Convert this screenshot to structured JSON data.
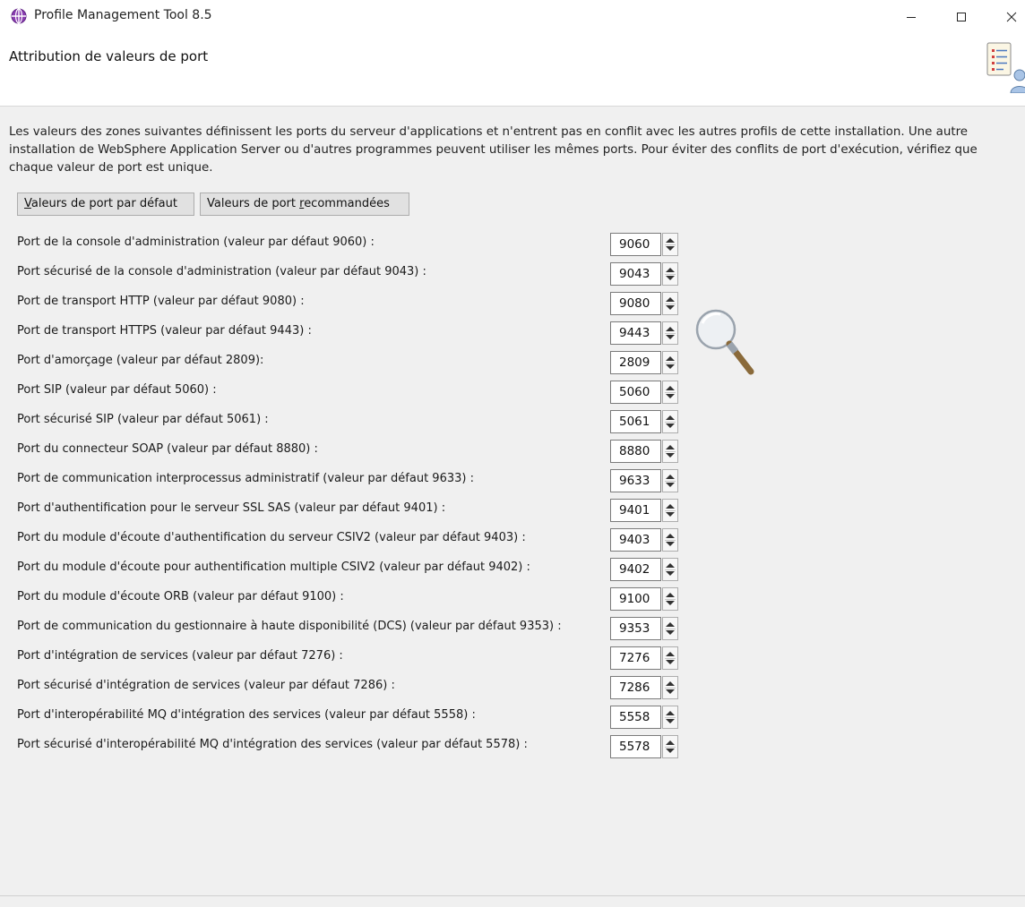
{
  "window": {
    "title": "Profile Management Tool 8.5",
    "controls": [
      "minimize-icon",
      "maximize-icon",
      "close-icon"
    ]
  },
  "header": {
    "title": "Attribution de valeurs de port",
    "image_icon": "checklist-user-icon"
  },
  "description": {
    "line1": "Les valeurs des zones suivantes définissent les ports du serveur d'applications et n'entrent pas en conflit avec les autres profils de cette installation. Une autre",
    "line2": "installation de WebSphere Application Server ou d'autres programmes peuvent utiliser les mêmes ports. Pour éviter des conflits de port d'exécution, vérifiez que",
    "line3": "chaque valeur de port est unique."
  },
  "buttons": {
    "default_ports": {
      "mnemonic": "V",
      "rest": "aleurs de port par défaut"
    },
    "recommended_ports": {
      "before": "Valeurs de port ",
      "mnemonic": "r",
      "after": "ecommandées"
    }
  },
  "ports": [
    {
      "label": "Port de la console d'administration (valeur par défaut 9060) :",
      "value": "9060"
    },
    {
      "label": "Port sécurisé de la console d'administration (valeur par défaut 9043) :",
      "value": "9043"
    },
    {
      "label": "Port de transport HTTP (valeur par défaut 9080) :",
      "value": "9080"
    },
    {
      "label": "Port de transport HTTPS (valeur par défaut 9443) :",
      "value": "9443"
    },
    {
      "label": "Port d'amorçage (valeur par défaut 2809):",
      "value": "2809"
    },
    {
      "label": "Port SIP (valeur par défaut 5060) :",
      "value": "5060"
    },
    {
      "label": "Port sécurisé SIP (valeur par défaut 5061) :",
      "value": "5061"
    },
    {
      "label": "Port du connecteur SOAP (valeur par défaut 8880) :",
      "value": "8880"
    },
    {
      "label": "Port de communication interprocessus administratif (valeur par défaut 9633) :",
      "value": "9633"
    },
    {
      "label": "Port d'authentification pour le serveur SSL SAS (valeur par défaut 9401) :",
      "value": "9401"
    },
    {
      "label": "Port du module d'écoute d'authentification du serveur CSIV2 (valeur par défaut 9403) :",
      "value": "9403"
    },
    {
      "label": "Port du module d'écoute pour authentification multiple CSIV2 (valeur par défaut 9402) :",
      "value": "9402"
    },
    {
      "label": "Port du module d'écoute ORB (valeur par défaut 9100) :",
      "value": "9100"
    },
    {
      "label": "Port de communication du gestionnaire à haute disponibilité (DCS) (valeur par défaut 9353) :",
      "value": "9353"
    },
    {
      "label": "Port d'intégration de services (valeur par défaut 7276) :",
      "value": "7276"
    },
    {
      "label": "Port sécurisé d'intégration de services (valeur par défaut 7286) :",
      "value": "7286"
    },
    {
      "label": "Port d'interopérabilité MQ d'intégration des services (valeur par défaut 5558) :",
      "value": "5558"
    },
    {
      "label": "Port sécurisé d'interopérabilité MQ d'intégration des services (valeur par défaut 5578) :",
      "value": "5578"
    }
  ],
  "decor": {
    "magnifier_icon": "magnifier-icon"
  }
}
